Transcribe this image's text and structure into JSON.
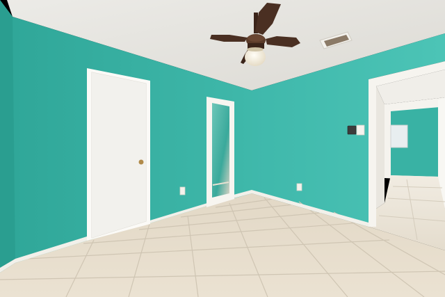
{
  "scene": {
    "subject": "empty-bedroom-interior",
    "colors": {
      "wall_left": "#3db5a8",
      "wall_back": "#42bcae",
      "wall_right": "#46c0b2",
      "ceiling": "#e9e7e2",
      "floor_tile": "#e6dccb",
      "grout": "#c9bfae",
      "trim": "#f4f2ee",
      "door": "#f3f2ef",
      "fan_blade": "#4a2f22",
      "light_glass": "#f4efe2"
    },
    "objects": [
      {
        "name": "ceiling-fan-with-light",
        "icon": "ceiling-fan-icon"
      },
      {
        "name": "ceiling-air-vent",
        "icon": "vent-icon"
      },
      {
        "name": "closed-white-door",
        "icon": "door-icon"
      },
      {
        "name": "mirrored-closet-door",
        "icon": "mirror-icon"
      },
      {
        "name": "open-doorway-to-hallway",
        "icon": "doorway-icon"
      },
      {
        "name": "thermostat",
        "icon": "thermostat-icon"
      },
      {
        "name": "light-switch",
        "icon": "switch-icon"
      },
      {
        "name": "electrical-outlets",
        "icon": "outlet-icon"
      },
      {
        "name": "tile-floor",
        "icon": "tile-icon"
      }
    ]
  }
}
